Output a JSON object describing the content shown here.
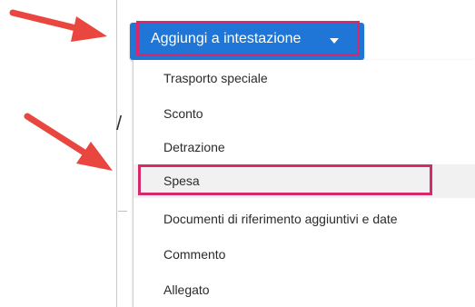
{
  "dropdown": {
    "label": "Aggiungi a intestazione",
    "icon": "caret-down-icon"
  },
  "menu": {
    "items": [
      {
        "label": "Trasporto speciale"
      },
      {
        "label": "Sconto"
      },
      {
        "label": "Detrazione"
      },
      {
        "label": "Spesa"
      },
      {
        "label": "Documenti di riferimento aggiuntivi e date"
      },
      {
        "label": "Commento"
      },
      {
        "label": "Allegato"
      }
    ],
    "highlighted_item": "Spesa"
  },
  "colors": {
    "button_bg": "#1f76d6",
    "highlight_border": "#d6286b",
    "arrow": "#e8463f",
    "hover_bg": "#f1f1f1"
  },
  "background": {
    "partial_glyph": "/"
  }
}
